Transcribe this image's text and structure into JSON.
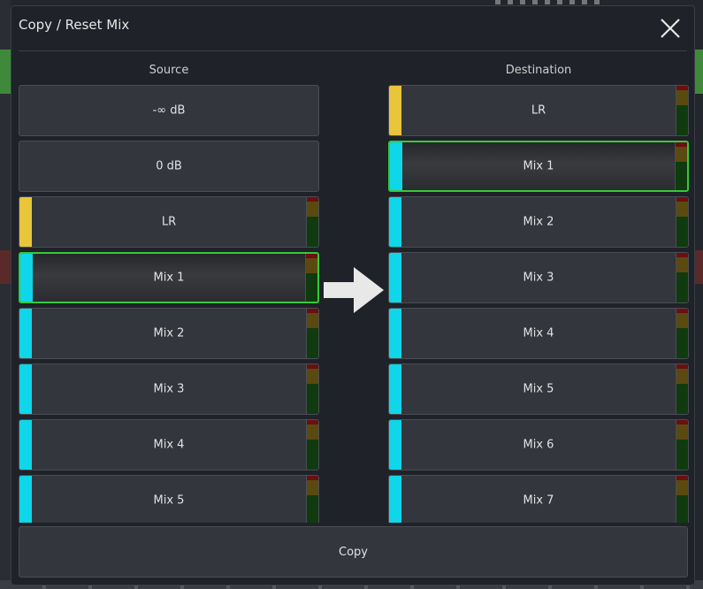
{
  "dialog": {
    "title": "Copy / Reset Mix",
    "close_icon": "close-icon",
    "source_heading": "Source",
    "destination_heading": "Destination",
    "copy_label": "Copy"
  },
  "colors": {
    "lr": "#e8c53a",
    "mix": "#0fd6e8",
    "selected_border": "#35c93a"
  },
  "source": [
    {
      "label": "-∞ dB",
      "swatch": null,
      "meter": false,
      "selected": false
    },
    {
      "label": "0 dB",
      "swatch": null,
      "meter": false,
      "selected": false
    },
    {
      "label": "LR",
      "swatch": "lr",
      "meter": true,
      "selected": false
    },
    {
      "label": "Mix 1",
      "swatch": "mix",
      "meter": true,
      "selected": true
    },
    {
      "label": "Mix 2",
      "swatch": "mix",
      "meter": true,
      "selected": false
    },
    {
      "label": "Mix 3",
      "swatch": "mix",
      "meter": true,
      "selected": false
    },
    {
      "label": "Mix 4",
      "swatch": "mix",
      "meter": true,
      "selected": false
    },
    {
      "label": "Mix 5",
      "swatch": "mix",
      "meter": true,
      "selected": false
    }
  ],
  "destination": [
    {
      "label": "LR",
      "swatch": "lr",
      "meter": true,
      "selected": false
    },
    {
      "label": "Mix 1",
      "swatch": "mix",
      "meter": true,
      "selected": true
    },
    {
      "label": "Mix 2",
      "swatch": "mix",
      "meter": true,
      "selected": false
    },
    {
      "label": "Mix 3",
      "swatch": "mix",
      "meter": true,
      "selected": false
    },
    {
      "label": "Mix 4",
      "swatch": "mix",
      "meter": true,
      "selected": false
    },
    {
      "label": "Mix 5",
      "swatch": "mix",
      "meter": true,
      "selected": false
    },
    {
      "label": "Mix 6",
      "swatch": "mix",
      "meter": true,
      "selected": false
    },
    {
      "label": "Mix 7",
      "swatch": "mix",
      "meter": true,
      "selected": false
    }
  ]
}
